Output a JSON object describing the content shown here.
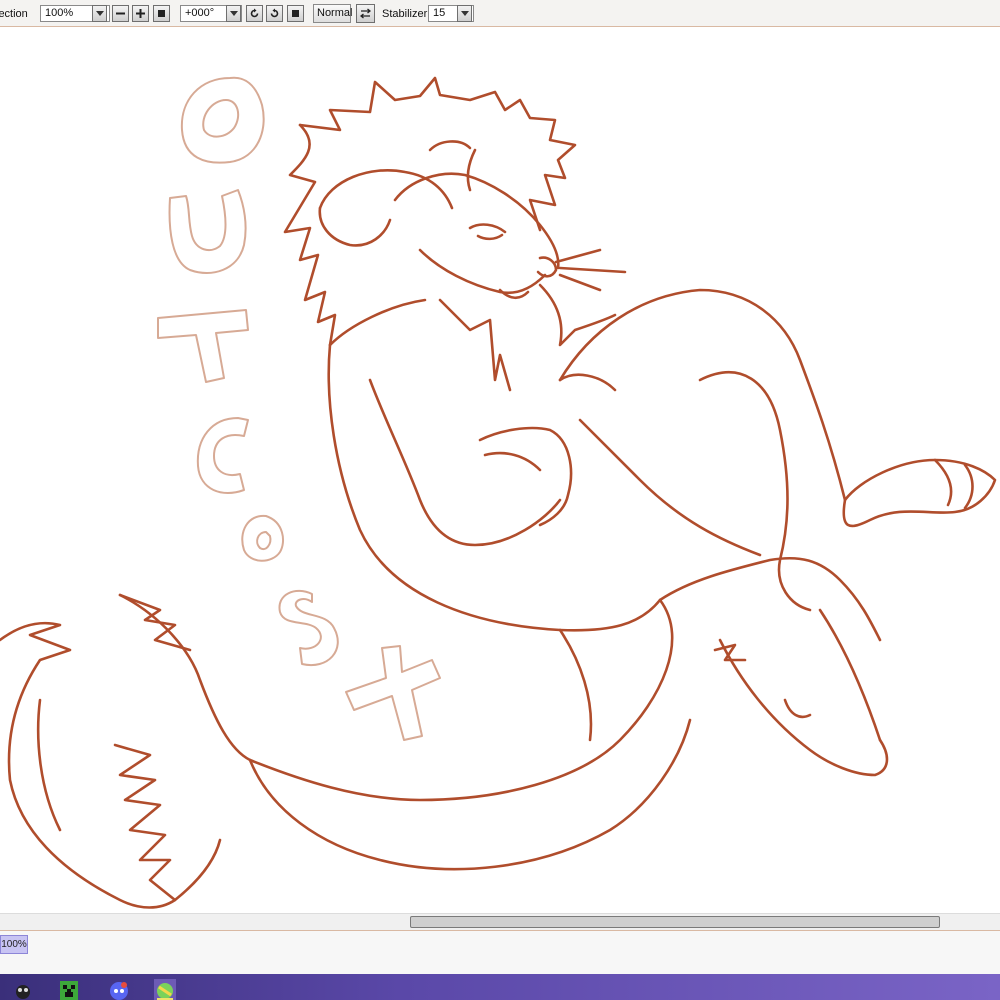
{
  "toolbar": {
    "selection_label": "lection",
    "zoom_value": "100%",
    "rotation_value": "+000°",
    "blend_value": "Normal",
    "stabilizer_label": "Stabilizer",
    "stabilizer_value": "15"
  },
  "canvas": {
    "side_text": "OUTCAST",
    "line_color": "#b04d2c",
    "letter_color": "#d7aa95"
  },
  "status": {
    "zoom_readout": "100%"
  },
  "taskbar": {
    "icons": [
      "app-icon",
      "minecraft-icon",
      "discord-icon",
      "paint-app-icon"
    ]
  },
  "colors": {
    "accent": "#b04d2c",
    "taskbar": "#5a48a8"
  }
}
